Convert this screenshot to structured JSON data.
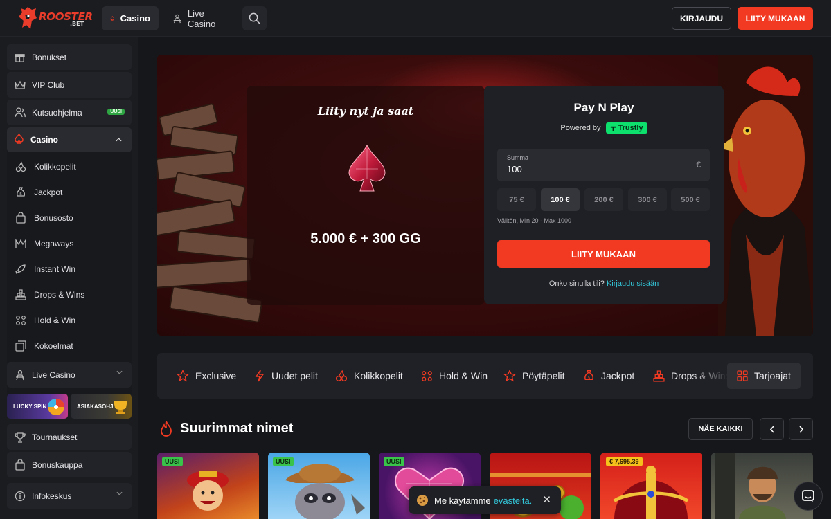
{
  "brand": {
    "name": "ROOSTER",
    "suffix": ".BET"
  },
  "topnav": {
    "casino": "Casino",
    "live_casino": "Live Casino",
    "login": "KIRJAUDU",
    "join": "LIITY MUKAAN"
  },
  "sidebar": {
    "bonuses": "Bonukset",
    "vip": "VIP Club",
    "referral": "Kutsuohjelma",
    "referral_badge": "UUSI",
    "casino": "Casino",
    "casino_items": [
      "Kolikkopelit",
      "Jackpot",
      "Bonusosto",
      "Megaways",
      "Instant Win",
      "Drops & Wins",
      "Hold & Win",
      "Kokoelmat"
    ],
    "live_casino": "Live Casino",
    "lucky_spin": "LUCKY SPIN",
    "asiakasohj": "ASIAKASOHJ",
    "tournaments": "Tournaukset",
    "bonus_shop": "Bonuskauppa",
    "info_center": "Infokeskus"
  },
  "hero": {
    "offer_title": "Liity nyt ja saat",
    "offer_amount": "5.000 € + 300 GG",
    "pnp_title": "Pay N Play",
    "powered_by": "Powered by",
    "trustly": "Trustly",
    "amount_label": "Summa",
    "amount_value": "100",
    "currency": "€",
    "chips": [
      "75 €",
      "100 €",
      "200 €",
      "300 €",
      "500 €"
    ],
    "selected_chip": "100 €",
    "hint": "Välitön, Min 20 - Max 1000",
    "join": "LIITY MUKAAN",
    "account_q": "Onko sinulla tili?",
    "account_link": "Kirjaudu sisään"
  },
  "categories": [
    "Exclusive",
    "Uudet pelit",
    "Kolikkopelit",
    "Hold & Win",
    "Pöytäpelit",
    "Jackpot",
    "Drops & Wins",
    "Tarjoajat"
  ],
  "section": {
    "title": "Suurimmat nimet",
    "see_all": "NÄE KAIKKI"
  },
  "games": {
    "new_tag": "UUSI",
    "jackpot_amount": "€ 7,695.39"
  },
  "cookie": {
    "text": "Me käytämme",
    "link": "evästeitä."
  },
  "colors": {
    "accent": "#f23a22",
    "link": "#33c7d9",
    "trustly": "#0ee06e",
    "new_badge": "#39c34a"
  }
}
